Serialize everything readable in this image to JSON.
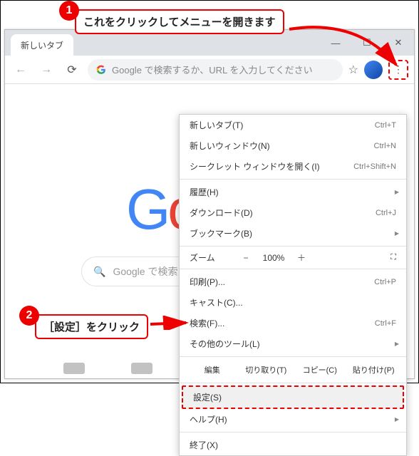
{
  "tab": {
    "title": "新しいタブ"
  },
  "window_buttons": {
    "minimize": "—",
    "maximize": "☐",
    "close": "✕"
  },
  "toolbar": {
    "back": "←",
    "forward": "→",
    "reload": "⟳",
    "omnibox_placeholder": "Google で検索するか、URL を入力してください",
    "star": "☆",
    "menu_dots": "⋮"
  },
  "logo": "Google",
  "search_placeholder": "Google で検索また",
  "search_icon": "🔍",
  "menu": {
    "new_tab": "新しいタブ(T)",
    "new_tab_key": "Ctrl+T",
    "new_window": "新しいウィンドウ(N)",
    "new_window_key": "Ctrl+N",
    "incognito": "シークレット ウィンドウを開く(I)",
    "incognito_key": "Ctrl+Shift+N",
    "history": "履歴(H)",
    "downloads": "ダウンロード(D)",
    "downloads_key": "Ctrl+J",
    "bookmarks": "ブックマーク(B)",
    "zoom_label": "ズーム",
    "zoom_minus": "−",
    "zoom_value": "100%",
    "zoom_plus": "＋",
    "fullscreen": "⛶",
    "print": "印刷(P)...",
    "print_key": "Ctrl+P",
    "cast": "キャスト(C)...",
    "find": "検索(F)...",
    "find_key": "Ctrl+F",
    "more_tools": "その他のツール(L)",
    "edit": "編集",
    "cut": "切り取り(T)",
    "copy": "コピー(C)",
    "paste": "貼り付け(P)",
    "settings": "設定(S)",
    "help": "ヘルプ(H)",
    "exit": "終了(X)"
  },
  "callouts": {
    "c1_num": "1",
    "c1_text": "これをクリックしてメニューを開きます",
    "c2_num": "2",
    "c2_text": "［設定］をクリック"
  }
}
